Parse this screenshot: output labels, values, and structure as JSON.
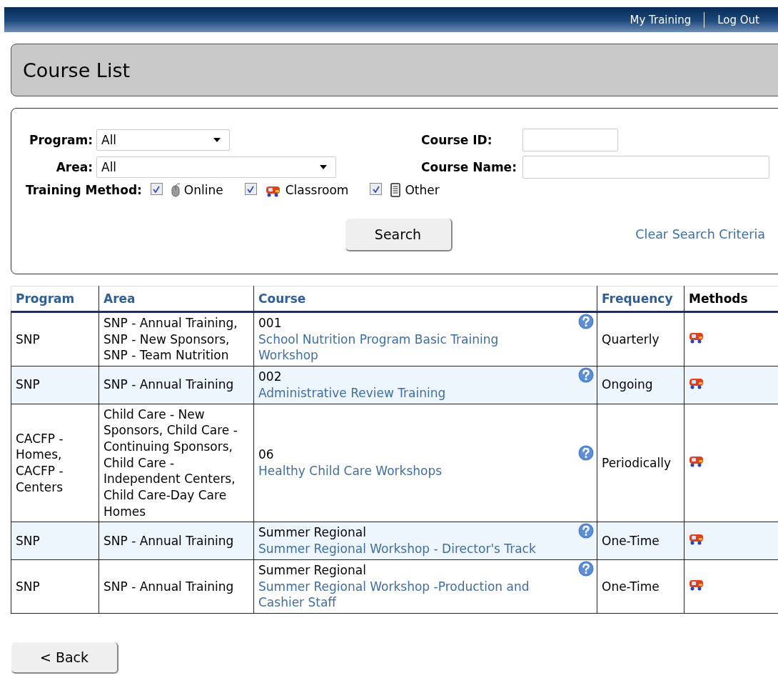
{
  "top_bar": {
    "links": [
      "My Training",
      "Log Out"
    ]
  },
  "page_title": "Course List",
  "search": {
    "program": {
      "label": "Program:",
      "value": "All"
    },
    "area": {
      "label": "Area:",
      "value": "All"
    },
    "course_id": {
      "label": "Course ID:"
    },
    "course_name": {
      "label": "Course Name:"
    },
    "training_method": {
      "label": "Training Method:",
      "options": [
        {
          "label": "Online",
          "kind": "online",
          "checked": true
        },
        {
          "label": "Classroom",
          "kind": "classroom",
          "checked": true
        },
        {
          "label": "Other",
          "kind": "other",
          "checked": true
        }
      ]
    },
    "search_button": "Search",
    "clear_link": "Clear Search Criteria"
  },
  "table": {
    "columns": [
      {
        "label": "Program",
        "sortable": true
      },
      {
        "label": "Area",
        "sortable": true
      },
      {
        "label": "Course",
        "sortable": true
      },
      {
        "label": "Frequency",
        "sortable": true
      },
      {
        "label": "Methods",
        "sortable": false
      }
    ],
    "rows": [
      {
        "program": "SNP",
        "area": "SNP - Annual Training, SNP - New Sponsors, SNP - Team Nutrition",
        "course_id": "001",
        "course_name": "School Nutrition Program Basic Training Workshop",
        "frequency": "Quarterly",
        "methods": [
          {
            "kind": "classroom"
          }
        ]
      },
      {
        "program": "SNP",
        "area": "SNP - Annual Training",
        "course_id": "002",
        "course_name": "Administrative Review Training",
        "frequency": "Ongoing",
        "methods": [
          {
            "kind": "classroom"
          }
        ]
      },
      {
        "program": "CACFP - Homes, CACFP - Centers",
        "area": "Child Care - New Sponsors, Child Care - Continuing Sponsors, Child Care - Independent Centers, Child Care-Day Care Homes",
        "course_id": "06",
        "course_name": "Healthy Child Care Workshops",
        "frequency": "Periodically",
        "methods": [
          {
            "kind": "classroom"
          }
        ]
      },
      {
        "program": "SNP",
        "area": "SNP - Annual Training",
        "course_id": "Summer Regional",
        "course_name": "Summer Regional Workshop - Director's Track",
        "frequency": "One-Time",
        "methods": [
          {
            "kind": "classroom"
          }
        ]
      },
      {
        "program": "SNP",
        "area": "SNP - Annual Training",
        "course_id": "Summer Regional",
        "course_name": "Summer Regional Workshop -Production and Cashier Staff",
        "frequency": "One-Time",
        "methods": [
          {
            "kind": "classroom"
          }
        ]
      }
    ]
  },
  "back_button": "< Back"
}
